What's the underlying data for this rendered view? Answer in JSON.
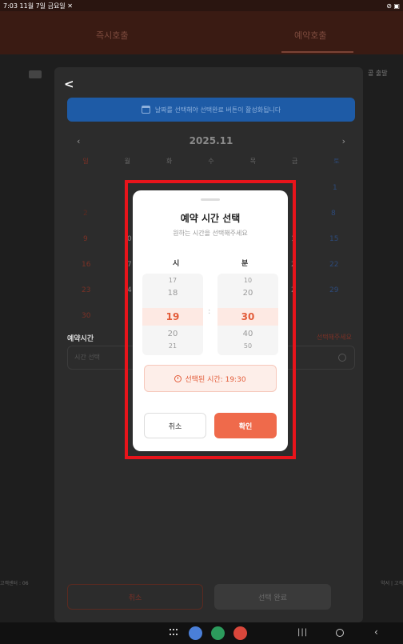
{
  "status_bar": {
    "left": "7:03 11월 7일 금요일 ✕",
    "right": "⊘ ▣"
  },
  "app_header": {
    "tab_left": "즉시호출",
    "tab_right": "예약호출"
  },
  "background": {
    "right_label": "콜 출발",
    "bottom_left": "고객센터 : 06",
    "bottom_right": "약서 | 고객"
  },
  "sheet": {
    "back_label": "<",
    "banner_text": "날짜를 선택해야 선택완료 버튼이 활성화됩니다",
    "calendar": {
      "prev": "‹",
      "next": "›",
      "title": "2025.11",
      "weekdays": [
        "일",
        "월",
        "화",
        "수",
        "목",
        "금",
        "토"
      ],
      "row1_sat": "1",
      "row2_sun": "2",
      "row2_sat": "8",
      "row3_sun": "9",
      "row3_sat": "15",
      "row4_sun": "16",
      "row4_sat": "22",
      "row5_sun": "23",
      "row5_sat": "29",
      "row6_sun": "30",
      "frag_7": "7",
      "frag_0": "0",
      "frag_4": "4",
      "frag_1": "1",
      "frag_2a": "2",
      "frag_2b": "2"
    },
    "reservation_label": "예약시간",
    "reservation_hint": "선택해주세요",
    "time_placeholder": "시간 선택",
    "cancel_label": "취소",
    "done_label": "선택 완료"
  },
  "modal": {
    "title": "예약 시간 선택",
    "subtitle": "원하는 시간을 선택해주세요",
    "hour_label": "시",
    "minute_label": "분",
    "hour_options": [
      "17",
      "18",
      "19",
      "20",
      "21"
    ],
    "minute_options": [
      "10",
      "20",
      "30",
      "40",
      "50"
    ],
    "separator": ":",
    "selected_text": "선택된 시간: 19:30",
    "cancel_label": "취소",
    "confirm_label": "확인",
    "colors": {
      "accent": "#ef6a4b",
      "selected_bg": "#fde9e3"
    }
  }
}
